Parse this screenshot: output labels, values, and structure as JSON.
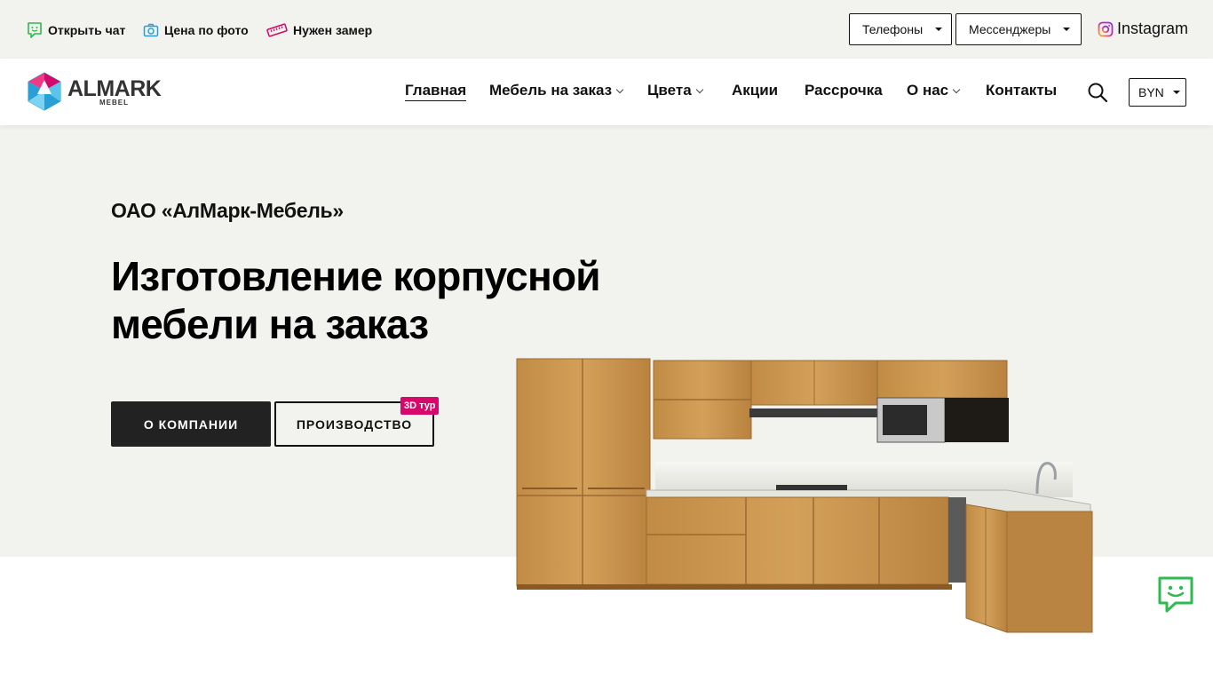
{
  "topbar": {
    "chat_label": "Открыть чат",
    "photo_price_label": "Цена по фото",
    "measure_label": "Нужен замер",
    "phones_label": "Телефоны",
    "messengers_label": "Мессенджеры",
    "instagram_label": "Instagram",
    "icons": [
      "chat-icon",
      "camera-icon",
      "ruler-icon",
      "instagram-icon"
    ],
    "accent_green": "#2dba4e",
    "accent_blue": "#2a9fd6",
    "accent_pink": "#d6086a"
  },
  "header": {
    "logo_text": "ALMARK",
    "logo_sub": "MEBEL",
    "nav": [
      {
        "label": "Главная",
        "active": true
      },
      {
        "label": "Мебель на заказ",
        "has_dropdown": true
      },
      {
        "label": "Цвета",
        "has_dropdown": true
      },
      {
        "label": "Акции"
      },
      {
        "label": "Рассрочка"
      },
      {
        "label": "О нас",
        "has_dropdown": true
      },
      {
        "label": "Контакты"
      }
    ],
    "currency": "BYN"
  },
  "hero": {
    "company": "ОАО «АлМарк-Мебель»",
    "headline_line1": "Изготовление корпусной",
    "headline_line2": "мебели на заказ",
    "about_button": "О КОМПАНИИ",
    "production_button": "ПРОИЗВОДСТВО",
    "tour_badge": "3D тур",
    "background": "#f2f2ee"
  },
  "chat_fab": {
    "icon": "chat-icon",
    "color": "#2dba4e"
  }
}
